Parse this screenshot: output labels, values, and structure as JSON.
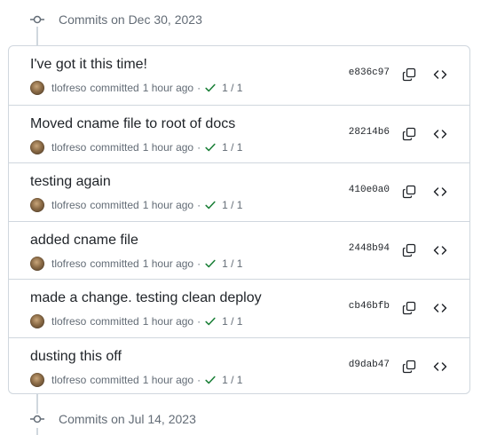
{
  "groups": [
    {
      "title": "Commits on Dec 30, 2023",
      "commits": [
        {
          "message": "I've got it this time!",
          "author": "tlofreso",
          "action": "committed",
          "time": "1 hour ago",
          "separator": "·",
          "checks": "1 / 1",
          "sha": "e836c97"
        },
        {
          "message": "Moved cname file to root of docs",
          "author": "tlofreso",
          "action": "committed",
          "time": "1 hour ago",
          "separator": "·",
          "checks": "1 / 1",
          "sha": "28214b6"
        },
        {
          "message": "testing again",
          "author": "tlofreso",
          "action": "committed",
          "time": "1 hour ago",
          "separator": "·",
          "checks": "1 / 1",
          "sha": "410e0a0"
        },
        {
          "message": "added cname file",
          "author": "tlofreso",
          "action": "committed",
          "time": "1 hour ago",
          "separator": "·",
          "checks": "1 / 1",
          "sha": "2448b94"
        },
        {
          "message": "made a change. testing clean deploy",
          "author": "tlofreso",
          "action": "committed",
          "time": "1 hour ago",
          "separator": "·",
          "checks": "1 / 1",
          "sha": "cb46bfb"
        },
        {
          "message": "dusting this off",
          "author": "tlofreso",
          "action": "committed",
          "time": "1 hour ago",
          "separator": "·",
          "checks": "1 / 1",
          "sha": "d9dab47"
        }
      ]
    },
    {
      "title": "Commits on Jul 14, 2023",
      "commits": []
    }
  ],
  "icons": {
    "commit_node": "git-commit-icon",
    "avatar": "avatar",
    "check": "check-icon",
    "copy": "copy-icon",
    "browse": "code-icon"
  },
  "colors": {
    "check": "#1a7f37",
    "border": "#d0d7de",
    "muted_text": "#636c76",
    "text": "#1f2328"
  }
}
